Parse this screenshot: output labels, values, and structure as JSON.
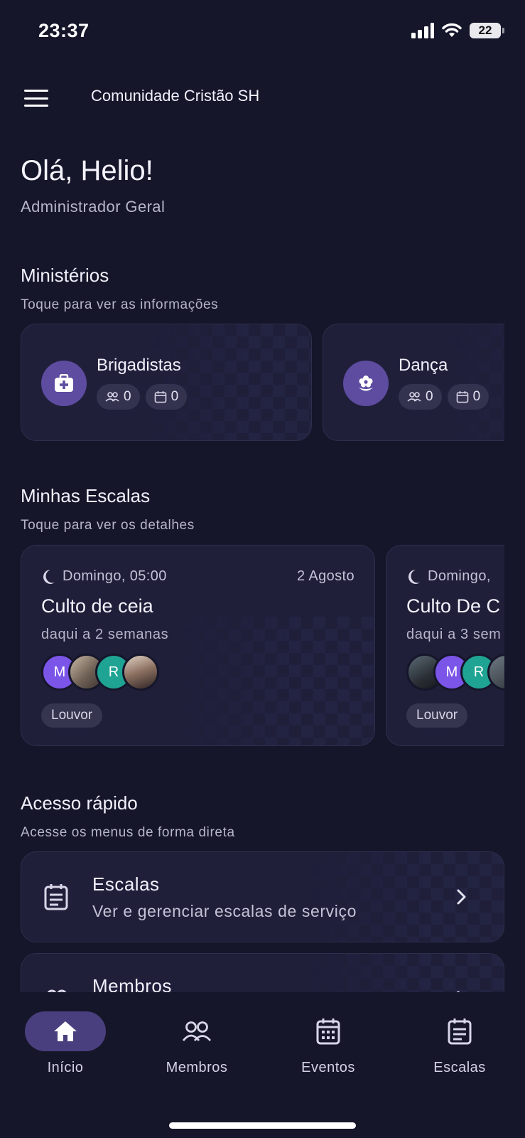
{
  "status_bar": {
    "time": "23:37",
    "battery": "22"
  },
  "app_bar": {
    "title": "Comunidade Cristão SH"
  },
  "greeting": {
    "hello": "Olá, Helio!",
    "role": "Administrador Geral"
  },
  "ministries": {
    "title": "Ministérios",
    "subtitle": "Toque para ver as informações",
    "items": [
      {
        "name": "Brigadistas",
        "icon": "first-aid-kit-icon",
        "members": "0",
        "events": "0"
      },
      {
        "name": "Dança",
        "icon": "flower-icon",
        "members": "0",
        "events": "0"
      }
    ]
  },
  "schedules": {
    "title": "Minhas Escalas",
    "subtitle": "Toque para ver os detalhes",
    "items": [
      {
        "when": "Domingo, 05:00",
        "date": "2 Agosto",
        "title": "Culto de ceia",
        "relative": "daqui a 2 semanas",
        "avatars": [
          "M",
          "",
          "R",
          ""
        ],
        "tag": "Louvor"
      },
      {
        "when": "Domingo,",
        "title": "Culto De C",
        "relative": "daqui a 3 sem",
        "avatars": [
          "",
          "M",
          "R",
          ""
        ],
        "tag": "Louvor"
      }
    ]
  },
  "quick_access": {
    "title": "Acesso rápido",
    "subtitle": "Acesse os menus de forma direta",
    "items": [
      {
        "title": "Escalas",
        "subtitle": "Ver e gerenciar escalas de serviço",
        "icon": "schedule-list-icon"
      },
      {
        "title": "Membros",
        "icon": "members-icon"
      }
    ]
  },
  "bottom_nav": {
    "items": [
      {
        "label": "Início",
        "icon": "home-icon",
        "active": true
      },
      {
        "label": "Membros",
        "icon": "members-icon"
      },
      {
        "label": "Eventos",
        "icon": "calendar-icon"
      },
      {
        "label": "Escalas",
        "icon": "schedule-list-icon"
      }
    ]
  },
  "colors": {
    "background": "#15162a",
    "card": "#201f3a",
    "accent": "#5d4ca0",
    "avatar_purple": "#7b55e8",
    "avatar_teal": "#1fa393"
  }
}
